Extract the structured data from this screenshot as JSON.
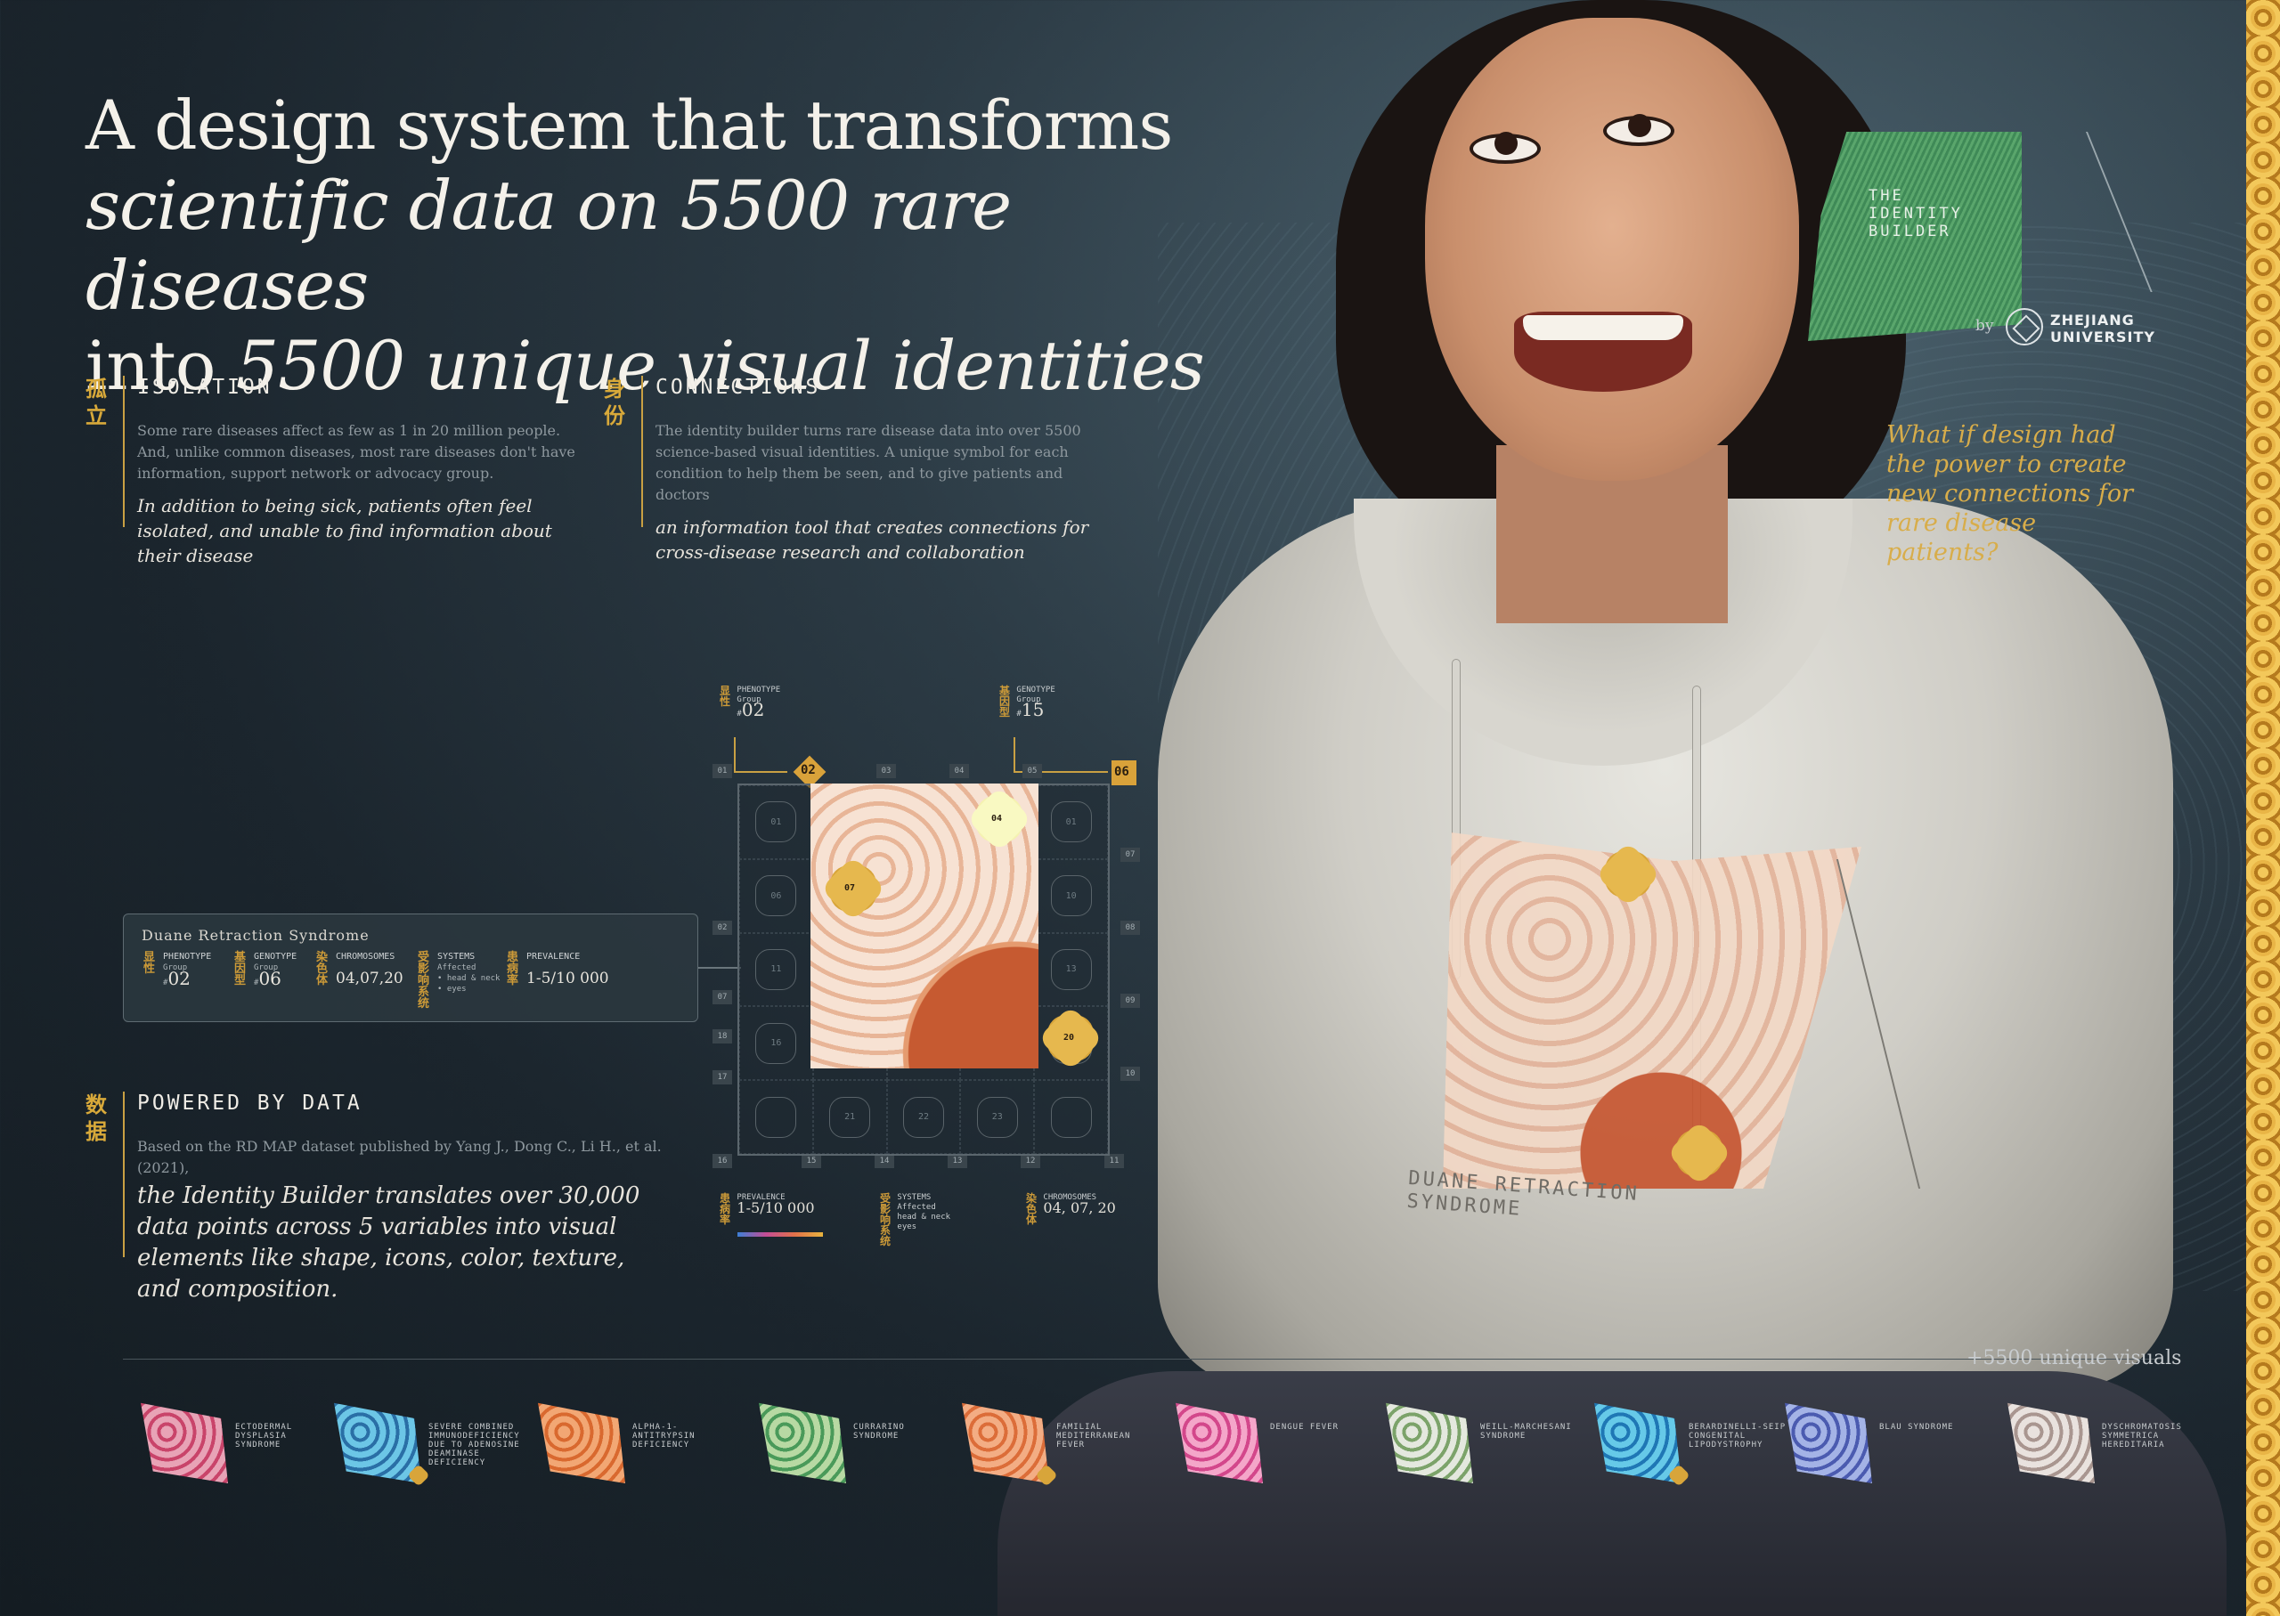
{
  "headline": {
    "line1": "A design system that transforms",
    "line2": "scientific data on 5500 rare diseases",
    "line3_pre": "into ",
    "line3_it": "5500 unique visual identities"
  },
  "isolation": {
    "glyph": "孤立",
    "heading": "ISOLATION",
    "small": "Some rare diseases affect as few as 1 in 20 million people. And, unlike common diseases, most rare diseases don't have information, support network or advocacy group.",
    "italic": "In addition to being sick, patients often feel isolated, and unable to find information about their disease"
  },
  "connections": {
    "glyph": "身份",
    "heading": "CONNECTIONS",
    "small": "The identity builder turns rare disease data into over 5500 science-based visual identities. A unique symbol for each condition to help them be seen, and to give patients and doctors",
    "italic": "an information tool that creates connections for cross-disease research and collaboration"
  },
  "powered": {
    "glyph": "数据",
    "heading": "POWERED BY DATA",
    "small": "Based on the RD MAP dataset published by Yang J., Dong C., Li H., et al. (2021),",
    "italic": "the Identity Builder translates over 30,000 data points across 5 variables into visual elements like shape, icons, color, texture, and composition."
  },
  "badge": {
    "title": "THE IDENTITY BUILDER",
    "by": "by",
    "org_line1": "ZHEJIANG",
    "org_line2": "UNIVERSITY"
  },
  "promo_question": "What if design had the power to create new connections for rare disease patients?",
  "shirt_print": "DUANE RETRACTION SYNDROME",
  "info_card": {
    "name": "Duane Retraction Syndrome",
    "phenotype": {
      "cn": "显性",
      "label": "PHENOTYPE",
      "sub": "Group",
      "hash": "#",
      "value": "02"
    },
    "genotype": {
      "cn": "基因型",
      "label": "GENOTYPE",
      "sub": "Group",
      "hash": "#",
      "value": "06"
    },
    "chromosomes": {
      "cn": "染色体",
      "label": "CHROMOSOMES",
      "value": "04,07,20"
    },
    "systems": {
      "cn": "受影响系统",
      "label": "SYSTEMS",
      "sub": "Affected",
      "items": "• head & neck\n• eyes"
    },
    "prevalence": {
      "cn": "患病率",
      "label": "PREVALENCE",
      "value": "1-5/10 000"
    }
  },
  "diagram": {
    "phenotype_top": {
      "cn": "显性",
      "label": "PHENOTYPE",
      "sub": "Group",
      "hash": "#",
      "value": "02"
    },
    "genotype_top": {
      "cn": "基因型",
      "label": "GENOTYPE",
      "sub": "Group",
      "hash": "#",
      "value": "15"
    },
    "phenotype_tag": "02",
    "genotype_tag": "06",
    "top_numbers": [
      "01",
      "03",
      "04",
      "05"
    ],
    "right_numbers": [
      "07",
      "08",
      "09",
      "10"
    ],
    "left_numbers": [
      "02",
      "07",
      "18",
      "17"
    ],
    "bottom_numbers": [
      "16",
      "15",
      "14",
      "13",
      "12",
      "11"
    ],
    "cells": [
      "01",
      "",
      "",
      "",
      "01",
      "06",
      "",
      "",
      "",
      "10",
      "11",
      "",
      "",
      "",
      "13",
      "16",
      "",
      "",
      "",
      "",
      "",
      "21",
      "22",
      "23",
      ""
    ],
    "marker_04": "04",
    "marker_07": "07",
    "marker_20": "20",
    "bottom_prevalence": {
      "cn": "患病率",
      "label": "PREVALENCE",
      "value": "1-5/10 000"
    },
    "bottom_systems": {
      "cn": "受影响系统",
      "label": "SYSTEMS",
      "sub": "Affected",
      "items": "head & neck\neyes"
    },
    "bottom_chromosomes": {
      "cn": "染色体",
      "label": "CHROMOSOMES",
      "value": "04, 07, 20"
    }
  },
  "gallery": {
    "count": "+5500  unique visuals",
    "items": [
      {
        "label": "ECTODERMAL DYSPLASIA SYNDROME",
        "colors": [
          "#e8a3b6",
          "#c9446a"
        ]
      },
      {
        "label": "SEVERE COMBINED IMMUNODEFICIENCY DUE TO ADENOSINE DEAMINASE DEFICIENCY",
        "colors": [
          "#6cc6e6",
          "#2a6fa6"
        ]
      },
      {
        "label": "ALPHA-1-ANTITRYPSIN DEFICIENCY",
        "colors": [
          "#f2a774",
          "#d9692f"
        ]
      },
      {
        "label": "CURRARINO SYNDROME",
        "colors": [
          "#b7d9a3",
          "#4a9a5a"
        ]
      },
      {
        "label": "FAMILIAL MEDITERRANEAN FEVER",
        "colors": [
          "#f3ad84",
          "#dc6d39"
        ]
      },
      {
        "label": "DENGUE FEVER",
        "colors": [
          "#f4a6c9",
          "#d3478b"
        ]
      },
      {
        "label": "WEILL-MARCHESANI SYNDROME",
        "colors": [
          "#e4e8de",
          "#7ca36a"
        ]
      },
      {
        "label": "BERARDINELLI-SEIP CONGENITAL LIPODYSTROPHY",
        "colors": [
          "#66c9e8",
          "#1f77b5"
        ]
      },
      {
        "label": "BLAU SYNDROME",
        "colors": [
          "#a4b3e6",
          "#4b5bb0"
        ]
      },
      {
        "label": "DYSCHROMATOSIS SYMMETRICA HEREDITARIA",
        "colors": [
          "#e9e2de",
          "#a99690"
        ]
      }
    ]
  },
  "colors": {
    "accent_gold": "#d8a53a",
    "background": "#1b252d"
  }
}
